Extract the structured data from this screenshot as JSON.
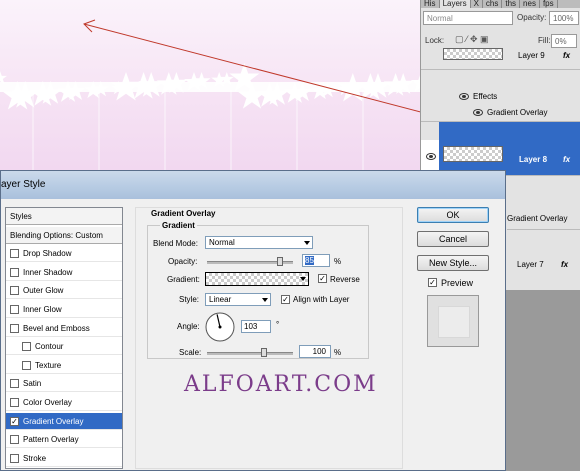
{
  "layers_panel": {
    "tabs": [
      "His",
      "Layers",
      "X",
      "chs",
      "ths",
      "nes",
      "fps"
    ],
    "blend_mode": "Normal",
    "opacity_label": "Opacity:",
    "opacity_value": "100%",
    "lock_label": "Lock:",
    "fill_label": "Fill:",
    "fill_value": "0%",
    "layer9_name": "Layer 9",
    "effects_label": "Effects",
    "gradient_overlay_effect": "Gradient Overlay",
    "layer8_name": "Layer 8",
    "fx_label": "fx",
    "gradient_overlay_behind": "Gradient Overlay",
    "layer7_name": "Layer 7"
  },
  "dialog": {
    "title": "ayer Style",
    "style_list": [
      {
        "label": "Styles",
        "checkbox": false,
        "checked": false,
        "indent": false,
        "head": true
      },
      {
        "label": "Blending Options: Custom",
        "checkbox": false,
        "checked": false,
        "indent": false,
        "head": true
      },
      {
        "label": "Drop Shadow",
        "checkbox": true,
        "checked": false,
        "indent": false
      },
      {
        "label": "Inner Shadow",
        "checkbox": true,
        "checked": false,
        "indent": false
      },
      {
        "label": "Outer Glow",
        "checkbox": true,
        "checked": false,
        "indent": false
      },
      {
        "label": "Inner Glow",
        "checkbox": true,
        "checked": false,
        "indent": false
      },
      {
        "label": "Bevel and Emboss",
        "checkbox": true,
        "checked": false,
        "indent": false
      },
      {
        "label": "Contour",
        "checkbox": true,
        "checked": false,
        "indent": true
      },
      {
        "label": "Texture",
        "checkbox": true,
        "checked": false,
        "indent": true
      },
      {
        "label": "Satin",
        "checkbox": true,
        "checked": false,
        "indent": false
      },
      {
        "label": "Color Overlay",
        "checkbox": true,
        "checked": false,
        "indent": false
      },
      {
        "label": "Gradient Overlay",
        "checkbox": true,
        "checked": true,
        "indent": false,
        "active": true
      },
      {
        "label": "Pattern Overlay",
        "checkbox": true,
        "checked": false,
        "indent": false
      },
      {
        "label": "Stroke",
        "checkbox": true,
        "checked": false,
        "indent": false
      }
    ],
    "section_title": "Gradient Overlay",
    "group_title": "Gradient",
    "blend_mode_label": "Blend Mode:",
    "blend_mode_value": "Normal",
    "opacity_label": "Opacity:",
    "opacity_value": "85",
    "opacity_level": 85,
    "percent": "%",
    "gradient_label": "Gradient:",
    "reverse_label": "Reverse",
    "reverse_checked": true,
    "style_label": "Style:",
    "style_value": "Linear",
    "align_label": "Align with Layer",
    "align_checked": true,
    "angle_label": "Angle:",
    "angle_value": "103",
    "degree": "°",
    "scale_label": "Scale:",
    "scale_value": "100",
    "scale_level": 100,
    "ok_label": "OK",
    "cancel_label": "Cancel",
    "new_style_label": "New Style...",
    "preview_label": "Preview",
    "preview_checked": true
  },
  "watermark": "ALFOART.COM",
  "colors": {
    "selection": "#316ac5",
    "watermark": "#7b3c8a",
    "arrow": "#c0392b"
  }
}
